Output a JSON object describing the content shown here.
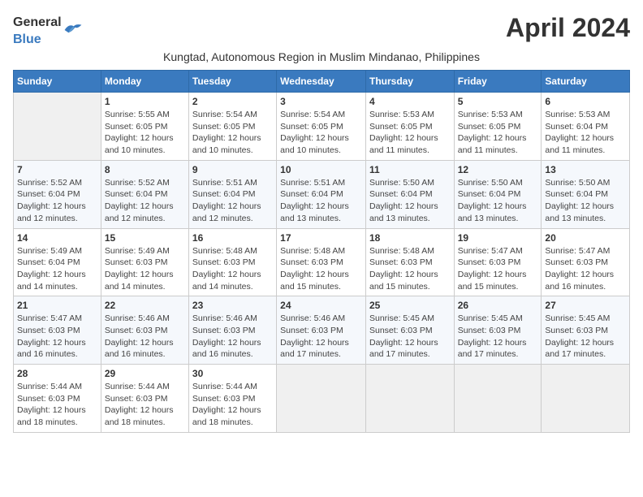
{
  "header": {
    "logo_general": "General",
    "logo_blue": "Blue",
    "month_title": "April 2024",
    "subtitle": "Kungtad, Autonomous Region in Muslim Mindanao, Philippines"
  },
  "days_of_week": [
    "Sunday",
    "Monday",
    "Tuesday",
    "Wednesday",
    "Thursday",
    "Friday",
    "Saturday"
  ],
  "weeks": [
    [
      {
        "day": "",
        "empty": true
      },
      {
        "day": "1",
        "sunrise": "Sunrise: 5:55 AM",
        "sunset": "Sunset: 6:05 PM",
        "daylight": "Daylight: 12 hours and 10 minutes."
      },
      {
        "day": "2",
        "sunrise": "Sunrise: 5:54 AM",
        "sunset": "Sunset: 6:05 PM",
        "daylight": "Daylight: 12 hours and 10 minutes."
      },
      {
        "day": "3",
        "sunrise": "Sunrise: 5:54 AM",
        "sunset": "Sunset: 6:05 PM",
        "daylight": "Daylight: 12 hours and 10 minutes."
      },
      {
        "day": "4",
        "sunrise": "Sunrise: 5:53 AM",
        "sunset": "Sunset: 6:05 PM",
        "daylight": "Daylight: 12 hours and 11 minutes."
      },
      {
        "day": "5",
        "sunrise": "Sunrise: 5:53 AM",
        "sunset": "Sunset: 6:05 PM",
        "daylight": "Daylight: 12 hours and 11 minutes."
      },
      {
        "day": "6",
        "sunrise": "Sunrise: 5:53 AM",
        "sunset": "Sunset: 6:04 PM",
        "daylight": "Daylight: 12 hours and 11 minutes."
      }
    ],
    [
      {
        "day": "7",
        "sunrise": "Sunrise: 5:52 AM",
        "sunset": "Sunset: 6:04 PM",
        "daylight": "Daylight: 12 hours and 12 minutes."
      },
      {
        "day": "8",
        "sunrise": "Sunrise: 5:52 AM",
        "sunset": "Sunset: 6:04 PM",
        "daylight": "Daylight: 12 hours and 12 minutes."
      },
      {
        "day": "9",
        "sunrise": "Sunrise: 5:51 AM",
        "sunset": "Sunset: 6:04 PM",
        "daylight": "Daylight: 12 hours and 12 minutes."
      },
      {
        "day": "10",
        "sunrise": "Sunrise: 5:51 AM",
        "sunset": "Sunset: 6:04 PM",
        "daylight": "Daylight: 12 hours and 13 minutes."
      },
      {
        "day": "11",
        "sunrise": "Sunrise: 5:50 AM",
        "sunset": "Sunset: 6:04 PM",
        "daylight": "Daylight: 12 hours and 13 minutes."
      },
      {
        "day": "12",
        "sunrise": "Sunrise: 5:50 AM",
        "sunset": "Sunset: 6:04 PM",
        "daylight": "Daylight: 12 hours and 13 minutes."
      },
      {
        "day": "13",
        "sunrise": "Sunrise: 5:50 AM",
        "sunset": "Sunset: 6:04 PM",
        "daylight": "Daylight: 12 hours and 13 minutes."
      }
    ],
    [
      {
        "day": "14",
        "sunrise": "Sunrise: 5:49 AM",
        "sunset": "Sunset: 6:04 PM",
        "daylight": "Daylight: 12 hours and 14 minutes."
      },
      {
        "day": "15",
        "sunrise": "Sunrise: 5:49 AM",
        "sunset": "Sunset: 6:03 PM",
        "daylight": "Daylight: 12 hours and 14 minutes."
      },
      {
        "day": "16",
        "sunrise": "Sunrise: 5:48 AM",
        "sunset": "Sunset: 6:03 PM",
        "daylight": "Daylight: 12 hours and 14 minutes."
      },
      {
        "day": "17",
        "sunrise": "Sunrise: 5:48 AM",
        "sunset": "Sunset: 6:03 PM",
        "daylight": "Daylight: 12 hours and 15 minutes."
      },
      {
        "day": "18",
        "sunrise": "Sunrise: 5:48 AM",
        "sunset": "Sunset: 6:03 PM",
        "daylight": "Daylight: 12 hours and 15 minutes."
      },
      {
        "day": "19",
        "sunrise": "Sunrise: 5:47 AM",
        "sunset": "Sunset: 6:03 PM",
        "daylight": "Daylight: 12 hours and 15 minutes."
      },
      {
        "day": "20",
        "sunrise": "Sunrise: 5:47 AM",
        "sunset": "Sunset: 6:03 PM",
        "daylight": "Daylight: 12 hours and 16 minutes."
      }
    ],
    [
      {
        "day": "21",
        "sunrise": "Sunrise: 5:47 AM",
        "sunset": "Sunset: 6:03 PM",
        "daylight": "Daylight: 12 hours and 16 minutes."
      },
      {
        "day": "22",
        "sunrise": "Sunrise: 5:46 AM",
        "sunset": "Sunset: 6:03 PM",
        "daylight": "Daylight: 12 hours and 16 minutes."
      },
      {
        "day": "23",
        "sunrise": "Sunrise: 5:46 AM",
        "sunset": "Sunset: 6:03 PM",
        "daylight": "Daylight: 12 hours and 16 minutes."
      },
      {
        "day": "24",
        "sunrise": "Sunrise: 5:46 AM",
        "sunset": "Sunset: 6:03 PM",
        "daylight": "Daylight: 12 hours and 17 minutes."
      },
      {
        "day": "25",
        "sunrise": "Sunrise: 5:45 AM",
        "sunset": "Sunset: 6:03 PM",
        "daylight": "Daylight: 12 hours and 17 minutes."
      },
      {
        "day": "26",
        "sunrise": "Sunrise: 5:45 AM",
        "sunset": "Sunset: 6:03 PM",
        "daylight": "Daylight: 12 hours and 17 minutes."
      },
      {
        "day": "27",
        "sunrise": "Sunrise: 5:45 AM",
        "sunset": "Sunset: 6:03 PM",
        "daylight": "Daylight: 12 hours and 17 minutes."
      }
    ],
    [
      {
        "day": "28",
        "sunrise": "Sunrise: 5:44 AM",
        "sunset": "Sunset: 6:03 PM",
        "daylight": "Daylight: 12 hours and 18 minutes."
      },
      {
        "day": "29",
        "sunrise": "Sunrise: 5:44 AM",
        "sunset": "Sunset: 6:03 PM",
        "daylight": "Daylight: 12 hours and 18 minutes."
      },
      {
        "day": "30",
        "sunrise": "Sunrise: 5:44 AM",
        "sunset": "Sunset: 6:03 PM",
        "daylight": "Daylight: 12 hours and 18 minutes."
      },
      {
        "day": "",
        "empty": true
      },
      {
        "day": "",
        "empty": true
      },
      {
        "day": "",
        "empty": true
      },
      {
        "day": "",
        "empty": true
      }
    ]
  ]
}
